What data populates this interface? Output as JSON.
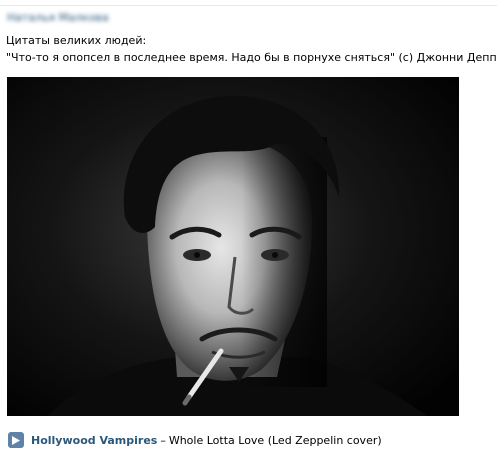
{
  "post": {
    "author_name": "Наталья Малкова",
    "text_line1": "Цитаты великих людей:",
    "text_line2": "\"Что-то я опопсел в последнее время. Надо бы в порнухе сняться\" (с) Джонни Депп"
  },
  "audio": {
    "play_icon": "play-icon",
    "artist": "Hollywood Vampires",
    "separator": "–",
    "title": "Whole Lotta Love (Led Zeppelin cover)"
  },
  "colors": {
    "link": "#2b587a",
    "play_button": "#5e82a8",
    "divider": "#e7e8ec"
  }
}
